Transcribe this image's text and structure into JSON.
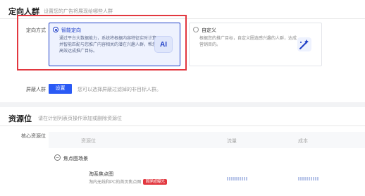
{
  "targeting": {
    "title": "定向人群",
    "hint": "设置您的广告将展现给哪些人群",
    "method_label": "定向方式",
    "smart": {
      "title": "智能定向",
      "desc": "通过平台大数据能力，系统将根据内容特征实时计算并智能匹配与您推广内容相关的潜在兴趣人群，帮您高效达成推广目标。",
      "icon_text": "AI"
    },
    "custom": {
      "title": "自定义",
      "desc": "根据您的推广目标，自定义圈选感兴趣的人群，达成营销目的。"
    },
    "exclude_label": "屏蔽人群",
    "exclude_button": "设置",
    "exclude_hint": "您可以选择屏蔽过滤掉的非目标人群。"
  },
  "resource": {
    "title": "资源位",
    "hint": "请在计划列表页操作添加或删除资源位",
    "core_label": "核心资源位",
    "columns": [
      "资源位",
      "流量",
      "成本"
    ],
    "group_label": "焦点图场景",
    "collapse_symbol": "−",
    "item": {
      "name": "淘系焦点图",
      "sub": "淘内无线和PC的首页焦点图",
      "badge": "首屏超曝光"
    }
  },
  "colors": {
    "primary": "#1f3fc7",
    "button": "#2a5af5",
    "highlight": "#e2373f"
  }
}
